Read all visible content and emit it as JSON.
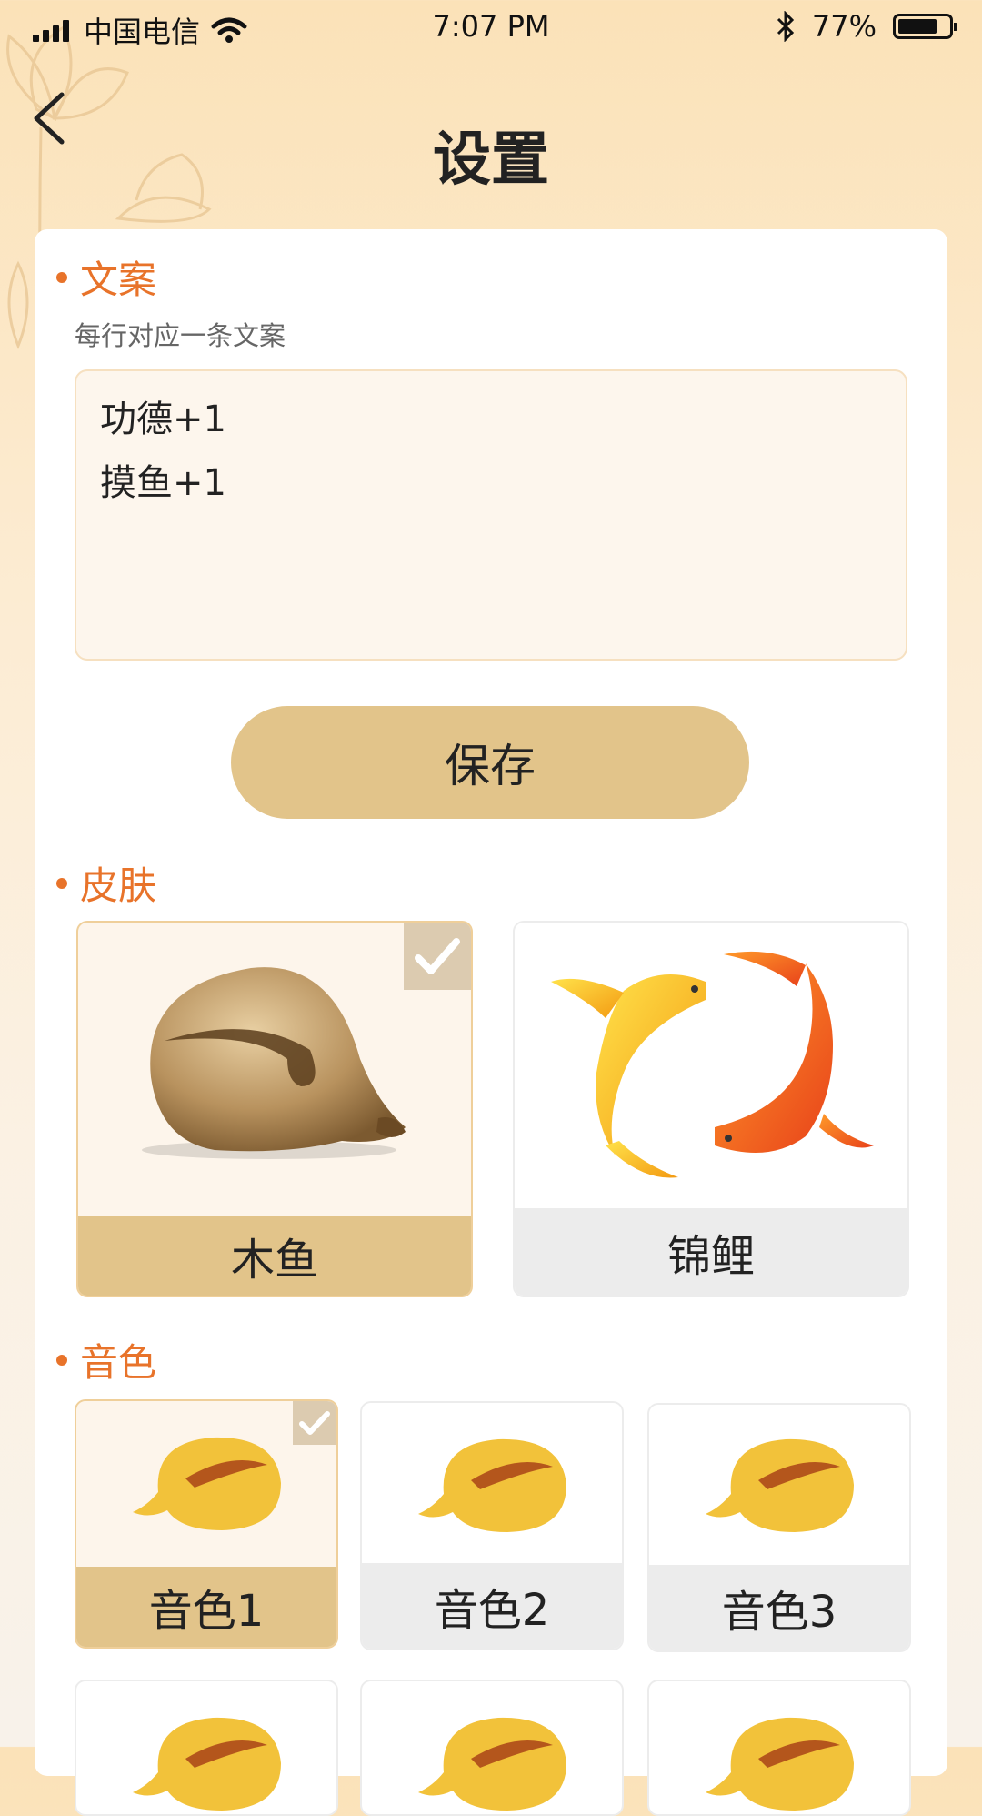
{
  "status_bar": {
    "carrier": "中国电信",
    "time": "7:07 PM",
    "battery": "77%",
    "battery_level": 0.77
  },
  "header": {
    "title": "设置"
  },
  "copy_section": {
    "title": "文案",
    "hint": "每行对应一条文案",
    "text": "功德+1\n摸鱼+1",
    "save_label": "保存"
  },
  "skin_section": {
    "title": "皮肤",
    "items": [
      {
        "label": "木鱼",
        "selected": true,
        "icon": "wooden-fish-icon"
      },
      {
        "label": "锦鲤",
        "selected": false,
        "icon": "koi-fish-icon"
      }
    ]
  },
  "sound_section": {
    "title": "音色",
    "items": [
      {
        "label": "音色1",
        "selected": true
      },
      {
        "label": "音色2",
        "selected": false
      },
      {
        "label": "音色3",
        "selected": false
      }
    ]
  },
  "colors": {
    "accent": "#e8732a",
    "selected_label": "#e2c48a",
    "unselected_label": "#ececec"
  }
}
